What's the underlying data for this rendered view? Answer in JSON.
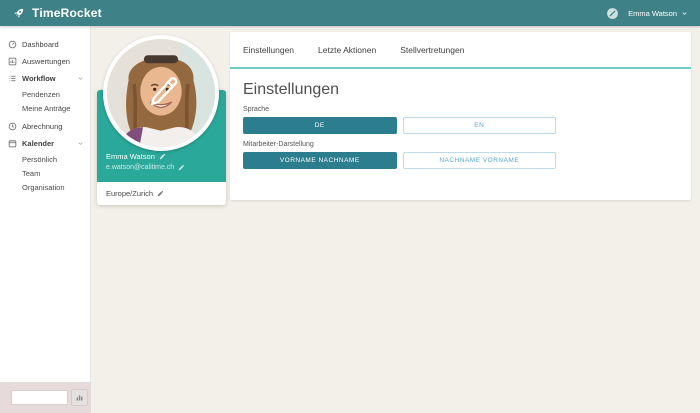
{
  "app": {
    "title": "TimeRocket"
  },
  "header": {
    "user_name": "Emma Watson"
  },
  "sidebar": {
    "items": [
      {
        "label": "Dashboard"
      },
      {
        "label": "Auswertungen"
      },
      {
        "label": "Workflow",
        "expanded": true
      },
      {
        "label": "Abrechnung"
      },
      {
        "label": "Kalender",
        "expanded": true
      }
    ],
    "workflow_children": [
      "Pendenzen",
      "Meine Anträge"
    ],
    "kalender_children": [
      "Persönlich",
      "Team",
      "Organisation"
    ],
    "search_value": ""
  },
  "profile": {
    "name": "Emma Watson",
    "email": "e.watson@calitime.ch",
    "timezone": "Europe/Zurich"
  },
  "tabs": [
    "Einstellungen",
    "Letzte Aktionen",
    "Stellvertretungen"
  ],
  "settings": {
    "heading": "Einstellungen",
    "language_label": "Sprache",
    "language_options": [
      "DE",
      "EN"
    ],
    "language_selected": "DE",
    "display_label": "Mitarbeiter-Darstellung",
    "display_options": [
      "VORNAME NACHNAME",
      "NACHNAME VORNAME"
    ],
    "display_selected": "VORNAME NACHNAME"
  },
  "colors": {
    "header_teal": "#3E8187",
    "card_teal": "#2AA899",
    "tab_underline": "#6FCBC6",
    "button_filled": "#2C7D8D",
    "button_outline_border": "#BBDAEA",
    "button_outline_text": "#58A7CE",
    "page_background": "#F3F0E9",
    "search_widget_background": "#E7DADA"
  }
}
